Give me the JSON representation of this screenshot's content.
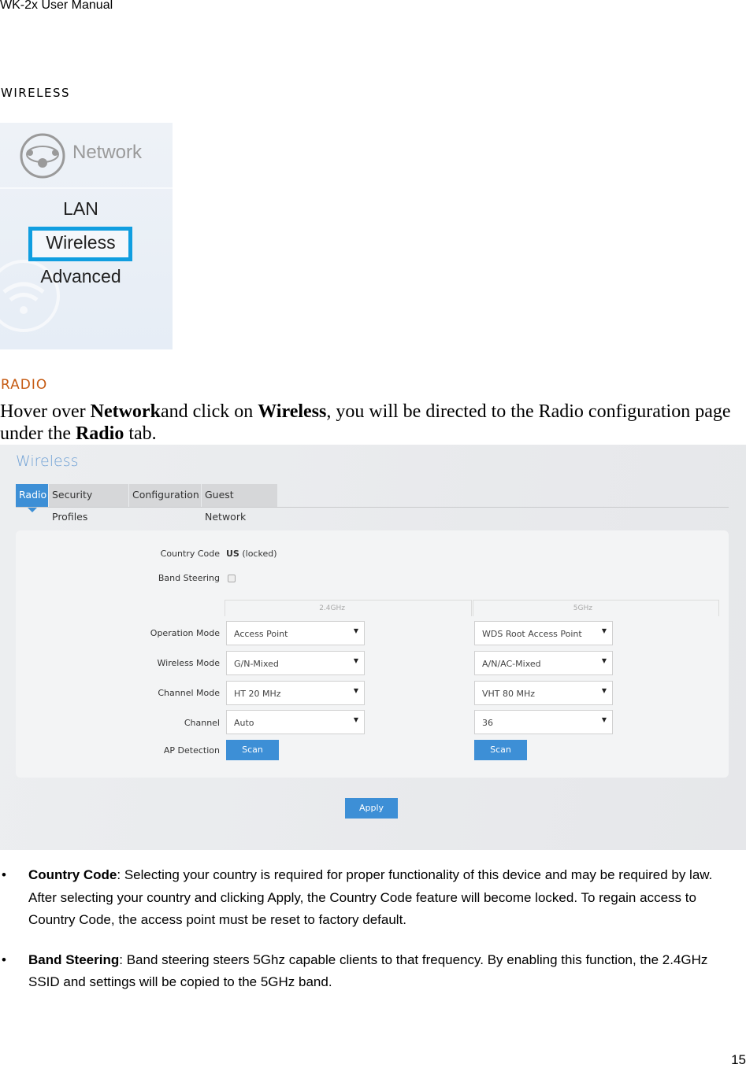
{
  "header": "WK-2x User Manual",
  "section_title": "WIRELESS",
  "nav_image": {
    "title": "Network",
    "items": [
      "LAN",
      "Wireless",
      "Advanced"
    ],
    "selected": "Wireless",
    "icon": "network-globe-icon",
    "highlight_color": "#109ee0"
  },
  "subsection_title": "RADIO",
  "intro": {
    "p1": "Hover over ",
    "b1": "Network",
    "p2": "and click on ",
    "b2": "Wireless",
    "p3": ", you will be directed to the Radio configuration page under the ",
    "b3": "Radio",
    "p4": " tab."
  },
  "screenshot": {
    "title": "Wireless",
    "tabs": [
      "Radio",
      "Security Profiles",
      "Configuration",
      "Guest Network"
    ],
    "active_tab": "Radio",
    "country_code_label": "Country Code",
    "country_code_value": "US",
    "country_code_note": "(locked)",
    "band_steering_label": "Band Steering",
    "band_steering_checked": false,
    "columns": [
      "2.4GHz",
      "5GHz"
    ],
    "rows": [
      {
        "label": "Operation Mode",
        "v24": "Access Point",
        "v5": "WDS Root Access Point"
      },
      {
        "label": "Wireless Mode",
        "v24": "G/N-Mixed",
        "v5": "A/N/AC-Mixed"
      },
      {
        "label": "Channel Mode",
        "v24": "HT 20 MHz",
        "v5": "VHT 80 MHz"
      },
      {
        "label": "Channel",
        "v24": "Auto",
        "v5": "36"
      }
    ],
    "ap_detection_label": "AP Detection",
    "scan_label": "Scan",
    "apply_label": "Apply",
    "accent": "#3d8fd6"
  },
  "bullets": [
    {
      "term": "Country Code",
      "text": ": Selecting your country is required for proper functionality of this device and may be required by law. After selecting your country and clicking Apply, the Country Code feature will become locked. To regain access to Country Code, the access point must be reset to factory default."
    },
    {
      "term": "Band Steering",
      "text": ": Band steering steers 5Ghz capable clients to that frequency. By enabling this function, the 2.4GHz SSID and settings will be copied to the 5GHz band."
    }
  ],
  "page_number": "15"
}
